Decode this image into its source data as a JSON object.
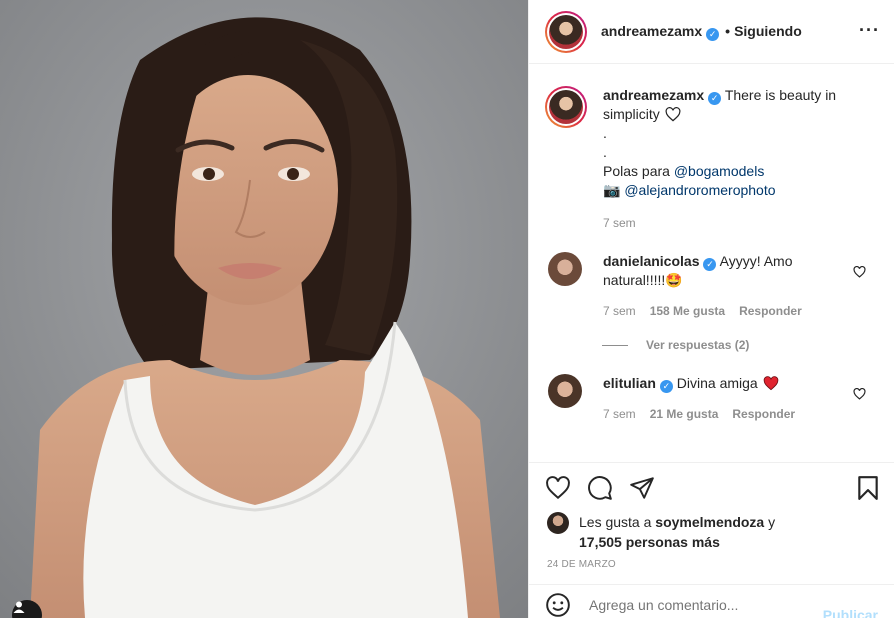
{
  "header": {
    "username": "andreamezamx",
    "separator": "•",
    "follow_state": "Siguiendo",
    "more_icon": "more-horizontal-icon"
  },
  "caption": {
    "username": "andreamezamx",
    "line1": "There is beauty in simplicity",
    "dot1": ".",
    "dot2": ".",
    "polas_prefix": "Polas para",
    "mention1": "@bogamodels",
    "camera_emoji": "📷",
    "mention2": "@alejandroromerophoto",
    "time": "7 sem"
  },
  "comments": [
    {
      "username": "danielanicolas",
      "text": "Ayyyy! Amo natural!!!!!",
      "emoji": "🤩",
      "time": "7 sem",
      "likes": "158 Me gusta",
      "reply": "Responder",
      "view_replies": "Ver respuestas (2)"
    },
    {
      "username": "elitulian",
      "text": "Divina amiga",
      "emoji": "❤️",
      "time": "7 sem",
      "likes": "21 Me gusta",
      "reply": "Responder"
    }
  ],
  "likes": {
    "prefix": "Les gusta a",
    "user": "soymelmendoza",
    "conj": "y",
    "others": "17,505 personas más"
  },
  "date": "24 DE MARZO",
  "add_comment": {
    "placeholder": "Agrega un comentario...",
    "post_label": "Publicar"
  },
  "colors": {
    "verified": "#3897f0",
    "link": "#00376b",
    "muted": "#8e8e8e",
    "publish_disabled": "#b2dffc"
  }
}
